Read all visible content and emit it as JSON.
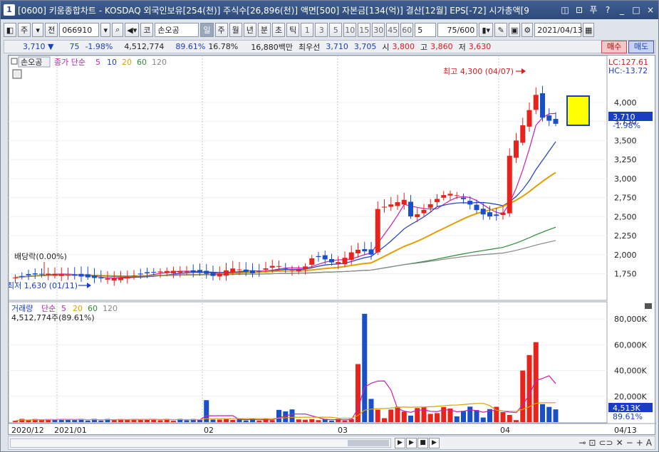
{
  "window": {
    "title": "[0600] 키움종합차트 - KOSDAQ 외국인보유[254(천)] 주식수[26,896(천)] 액면[500] 자본금[134(억)] 결산[12월] EPS[-72] 시가총액[9",
    "controls": [
      "◫",
      "⊡",
      "푸",
      "?",
      "_",
      "□",
      "×"
    ]
  },
  "toolbar": {
    "period_type": "주",
    "view": "전",
    "code": "066910",
    "market": "코",
    "stock_name": "손오공",
    "periods": [
      "일",
      "주",
      "월",
      "년",
      "분",
      "초",
      "틱"
    ],
    "active_period": "일",
    "intervals": [
      "1",
      "3",
      "5",
      "10",
      "15",
      "30",
      "45",
      "60"
    ],
    "interval_select": "5",
    "count": "75/600",
    "date": "2021/04/13"
  },
  "quote": {
    "price": "3,710 ▼",
    "change": "75",
    "change_rate": "-1.98%",
    "volume": "4,512,774",
    "vol_ratio": "89.61%",
    "turnover": "16.78%",
    "amount": "16,880백만",
    "best_label": "최우선",
    "ask": "3,710",
    "bid": "3,705",
    "open_label": "시",
    "open": "3,800",
    "high_label": "고",
    "high": "3,860",
    "low_label": "저",
    "low": "3,630",
    "buy_label": "매수",
    "sell_label": "매도"
  },
  "chart_labels": {
    "stock_tag": "손오공",
    "ma_title": "종가 단순",
    "ma_periods": [
      "5",
      "10",
      "20",
      "60",
      "120"
    ],
    "lc": "LC:127.61",
    "hc": "HC:-13.72",
    "high_annot": "최고 4,300 (04/07)",
    "low_annot": "최저 1,630 (01/11)",
    "dividend": "배당락(0.00%)",
    "price_tag": "3,710",
    "price_tag_rate": "-1.98%",
    "vol_title": "거래량",
    "vol_ma_title": "단순",
    "vol_ma_periods": [
      "5",
      "20",
      "60",
      "120"
    ],
    "vol_value": "4,512,774주(89.61%)",
    "vol_tag": "4,513K",
    "vol_tag_rate": "89.61%",
    "bottom_date": "04/13",
    "x_ticks": [
      "2020/12",
      "2021/01",
      "02",
      "03",
      "04"
    ]
  },
  "colors": {
    "up": "#e8231c",
    "down": "#1a4fc7",
    "ma5": "#c71fb3",
    "ma10": "#1a3ec2",
    "ma20": "#e0a000",
    "ma60": "#2e8b3a",
    "ma120": "#888888"
  },
  "chart_data": [
    {
      "type": "candlestick",
      "title": "손오공",
      "y_axis_ticks": [
        1750,
        2000,
        2250,
        2500,
        2750,
        3000,
        3250,
        3500,
        3750,
        4000
      ],
      "ylim": [
        1530,
        4430
      ],
      "annotations": {
        "high": 4300,
        "high_date": "04/07",
        "low": 1630,
        "low_date": "01/11"
      },
      "last": 3710
    },
    {
      "type": "bar",
      "title": "거래량",
      "y_axis_ticks": [
        "20,000K",
        "40,000K",
        "60,000K",
        "80,000K"
      ],
      "ylim": [
        0,
        90000
      ],
      "last": 4513
    }
  ]
}
